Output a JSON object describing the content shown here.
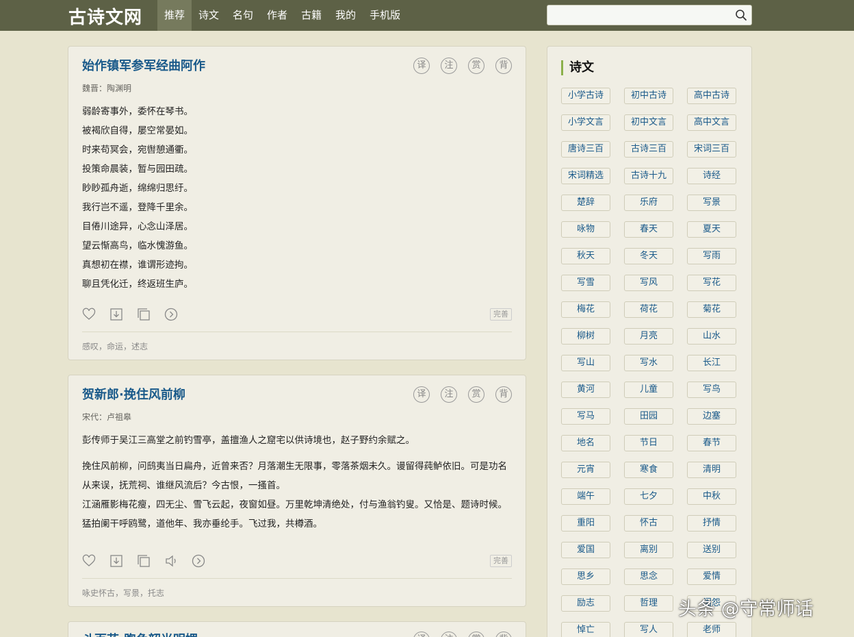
{
  "header": {
    "logo": "古诗文网",
    "nav": [
      "推荐",
      "诗文",
      "名句",
      "作者",
      "古籍",
      "我的",
      "手机版"
    ],
    "active_nav": "推荐",
    "search_placeholder": ""
  },
  "poems": [
    {
      "title": "始作镇军参军经曲阿作",
      "tools": [
        "译",
        "注",
        "赏",
        "背"
      ],
      "source": "魏晋：陶渊明",
      "lines": [
        "弱龄寄事外，委怀在琴书。",
        "被褐欣自得，屡空常晏如。",
        "时来苟冥会，宛辔憩通衢。",
        "投策命晨装，暂与园田疏。",
        "眇眇孤舟逝，绵绵归思纡。",
        "我行岂不遥，登降千里余。",
        "目倦川途异，心念山泽居。",
        "望云惭高鸟，临水愧游鱼。",
        "真想初在襟，谁谓形迹拘。",
        "聊且凭化迁，终返班生庐。"
      ],
      "badge": "完善",
      "tags": "感叹，命运，述志"
    },
    {
      "title": "贺新郎·挽住风前柳",
      "tools": [
        "译",
        "注",
        "赏",
        "背"
      ],
      "source": "宋代：卢祖皋",
      "preface": "彭传师于吴江三高堂之前钓雪亭，盖擅渔人之窟宅以供诗境也，赵子野约余赋之。",
      "paragraphs": [
        "挽住风前柳，问鸱夷当日扁舟，近曾来否？月落潮生无限事，零落茶烟未久。谩留得莼鲈依旧。可是功名从来误，抚荒祠、谁继风流后？今古恨，一搔首。",
        "江涵雁影梅花瘦，四无尘、雪飞云起，夜窗如昼。万里乾坤清绝处，付与渔翁钓叟。又恰是、题诗时候。猛拍阑干呼鸥鹭，道他年、我亦垂纶手。飞过我，共樽酒。"
      ],
      "badge": "完善",
      "tags": "咏史怀古，写景，托志"
    },
    {
      "title": "斗百花·煦色韶光明媚",
      "tools": [
        "译",
        "注",
        "赏",
        "背"
      ]
    }
  ],
  "sidebar": {
    "title": "诗文",
    "tags": [
      "小学古诗",
      "初中古诗",
      "高中古诗",
      "小学文言",
      "初中文言",
      "高中文言",
      "唐诗三百",
      "古诗三百",
      "宋词三百",
      "宋词精选",
      "古诗十九",
      "诗经",
      "楚辞",
      "乐府",
      "写景",
      "咏物",
      "春天",
      "夏天",
      "秋天",
      "冬天",
      "写雨",
      "写雪",
      "写风",
      "写花",
      "梅花",
      "荷花",
      "菊花",
      "柳树",
      "月亮",
      "山水",
      "写山",
      "写水",
      "长江",
      "黄河",
      "儿童",
      "写鸟",
      "写马",
      "田园",
      "边塞",
      "地名",
      "节日",
      "春节",
      "元宵",
      "寒食",
      "清明",
      "端午",
      "七夕",
      "中秋",
      "重阳",
      "怀古",
      "抒情",
      "爱国",
      "离别",
      "送别",
      "思乡",
      "思念",
      "爱情",
      "励志",
      "哲理",
      "闺怨",
      "悼亡",
      "写人",
      "老师"
    ]
  },
  "watermark": "头条 @守常师话"
}
